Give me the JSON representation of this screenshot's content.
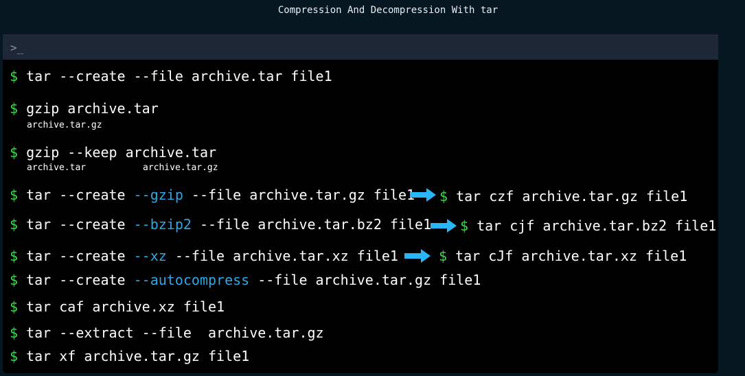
{
  "page": {
    "title": "Compression And Decompression With tar"
  },
  "terminal": {
    "prompt_icon": ">_",
    "prompt_symbol": "$",
    "commands": [
      {
        "pre": "tar --create --file archive.tar file1"
      },
      {
        "pre": "gzip archive.tar",
        "output": [
          "archive.tar.gz"
        ]
      },
      {
        "pre": "gzip --keep archive.tar",
        "output": [
          "archive.tar",
          "archive.tar.gz"
        ]
      },
      {
        "pre": "tar --create ",
        "flag": "--gzip",
        "post": " --file archive.tar.gz file1",
        "alt": "tar czf archive.tar.gz file1"
      },
      {
        "pre": "tar --create ",
        "flag": "--bzip2",
        "post": " --file archive.tar.bz2 file1",
        "alt": "tar cjf archive.tar.bz2 file1"
      },
      {
        "pre": "tar --create ",
        "flag": "--xz",
        "post": " --file archive.tar.xz file1",
        "alt": "tar cJf archive.tar.xz file1"
      },
      {
        "pre": "tar --create ",
        "flag": "--autocompress",
        "post": " --file archive.tar.gz file1"
      },
      {
        "pre": "tar caf archive.xz file1"
      },
      {
        "pre": "tar --extract --file  archive.tar.gz"
      },
      {
        "pre": "tar xf archive.tar.gz file1"
      }
    ]
  },
  "colors": {
    "background": "#071722",
    "terminal_bg": "#000000",
    "titlebar_bg": "#1e2735",
    "prompt": "#3fd84a",
    "flag_highlight": "#2fa7e6",
    "arrow": "#29b6f6"
  },
  "icons": {
    "prompt": "terminal-prompt-icon",
    "arrow": "right-arrow-icon"
  }
}
